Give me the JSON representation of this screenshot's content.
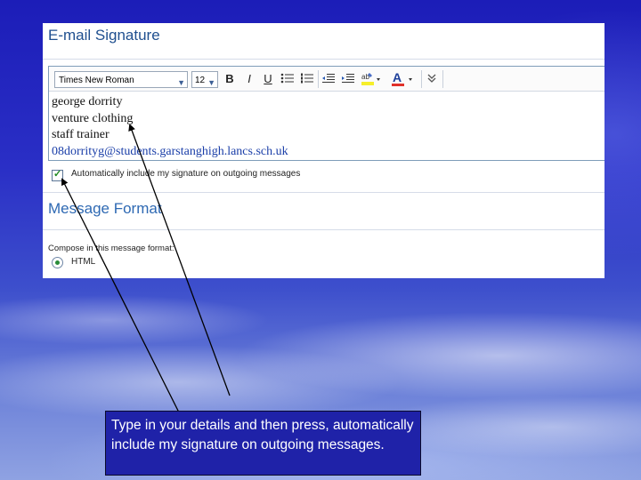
{
  "signature_section": {
    "title": "E-mail Signature",
    "toolbar": {
      "font": "Times New Roman",
      "size": "12",
      "bold_label": "B",
      "italic_label": "I",
      "underline_label": "U"
    },
    "signature_lines": [
      "george dorrity",
      "venture clothing",
      "staff trainer",
      "08dorrityg@students.garstanghigh.lancs.sch.uk"
    ],
    "auto_include": {
      "checked": true,
      "label": "Automatically include my signature on outgoing messages"
    }
  },
  "format_section": {
    "title": "Message Format",
    "compose_label": "Compose in this message format:",
    "options": [
      {
        "label": "HTML",
        "selected": true
      }
    ]
  },
  "callout": {
    "text": "Type in your details and then press, automatically include my signature on outgoing messages."
  },
  "colors": {
    "heading": "#1f4f8f",
    "callout_bg": "#1f22a8",
    "link": "#1a3ea8"
  }
}
